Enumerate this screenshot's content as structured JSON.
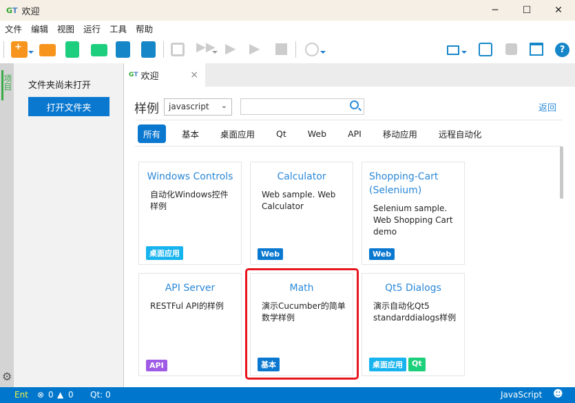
{
  "window": {
    "title": "欢迎",
    "logo": "GT",
    "controls": {
      "minimize": "─",
      "maximize": "☐",
      "close": "✕"
    }
  },
  "menu": [
    "文件",
    "编辑",
    "视图",
    "运行",
    "工具",
    "帮助"
  ],
  "toolbar": {
    "left_icons": [
      "new-js-file-icon",
      "open-folder-icon",
      "new-file-icon",
      "open-file-icon",
      "save-icon",
      "save-all-icon",
      "check-icon",
      "run-all-icon",
      "run-step-icon",
      "run-icon",
      "stop-icon",
      "qt-spy-icon"
    ],
    "right_icons": [
      "record-icon",
      "palette-icon",
      "box-icon",
      "layout-icon",
      "help-icon"
    ]
  },
  "activity": {
    "project_label": "项目"
  },
  "sidebar": {
    "empty_text": "文件夹尚未打开",
    "open_folder_button": "打开文件夹"
  },
  "tabs": [
    {
      "label": "欢迎",
      "close": "×"
    }
  ],
  "samples": {
    "heading": "样例",
    "language_select": "javascript",
    "search_placeholder": "",
    "back": "返回",
    "filters": [
      "所有",
      "基本",
      "桌面应用",
      "Qt",
      "Web",
      "API",
      "移动应用",
      "远程自动化"
    ],
    "active_filter": "所有",
    "cards": [
      {
        "title": "Windows Controls",
        "desc": "自动化Windows控件样例",
        "tags": [
          {
            "label": "桌面应用",
            "color": "#17b3ee"
          }
        ]
      },
      {
        "title": "Calculator",
        "desc": "Web sample. Web Calculator",
        "tags": [
          {
            "label": "Web",
            "color": "#0b78d0"
          }
        ]
      },
      {
        "title": "Shopping-Cart (Selenium)",
        "desc": "Selenium sample. Web Shopping Cart demo",
        "tags": [
          {
            "label": "Web",
            "color": "#0b78d0"
          }
        ]
      },
      {
        "title": "API Server",
        "desc": "RESTFul API的样例",
        "tags": [
          {
            "label": "API",
            "color": "#a05be6"
          }
        ]
      },
      {
        "title": "Math",
        "desc": "演示Cucumber的简单数学样例",
        "tags": [
          {
            "label": "基本",
            "color": "#0b78d0"
          }
        ],
        "highlighted": true
      },
      {
        "title": "Qt5 Dialogs",
        "desc": "演示自动化Qt5 standarddialogs样例",
        "tags": [
          {
            "label": "桌面应用",
            "color": "#17b3ee"
          },
          {
            "label": "Qt",
            "color": "#1ccf7a"
          }
        ]
      }
    ]
  },
  "status": {
    "mode": "Ent",
    "errors": "0",
    "warnings": "0",
    "qt": "Qt: 0",
    "language": "JavaScript"
  },
  "colors": {
    "accent": "#0b78d0",
    "status_bar": "#0077cc",
    "highlight": "#e8141c"
  }
}
